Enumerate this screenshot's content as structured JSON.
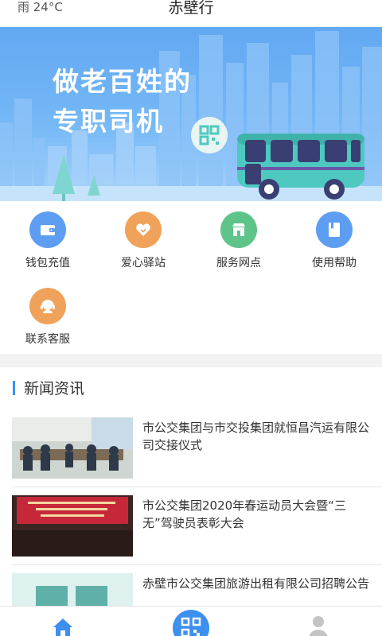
{
  "status_bar": {
    "weather": "雨  24°C"
  },
  "header": {
    "title": "赤壁行"
  },
  "banner": {
    "slogan_line1": "做老百姓的",
    "slogan_line2": "专职司机"
  },
  "menu": {
    "items": [
      {
        "label": "钱包充值",
        "icon": "wallet-icon",
        "color": "#5d9ef2"
      },
      {
        "label": "爱心驿站",
        "icon": "heart-icon",
        "color": "#f0a15a"
      },
      {
        "label": "服务网点",
        "icon": "store-icon",
        "color": "#5ec48a"
      },
      {
        "label": "使用帮助",
        "icon": "help-book-icon",
        "color": "#5d9ef2"
      },
      {
        "label": "联系客服",
        "icon": "customer-service-icon",
        "color": "#f0a15a"
      }
    ]
  },
  "news": {
    "title": "新闻资讯",
    "items": [
      {
        "title": "市公交集团与市交投集团就恒昌汽运有限公司交接仪式"
      },
      {
        "title": "市公交集团2020年春运动员大会暨“三无”驾驶员表彰大会"
      },
      {
        "title": "赤壁市公交集团旅游出租有限公司招聘公告"
      }
    ]
  },
  "tabbar": {
    "tabs": [
      {
        "icon": "home-icon"
      },
      {
        "icon": "qr-code-icon"
      },
      {
        "icon": "user-icon"
      }
    ]
  },
  "colors": {
    "accent": "#3d8ff0",
    "banner_top": "#62a8f2",
    "bus_body": "#4ec9c0"
  }
}
